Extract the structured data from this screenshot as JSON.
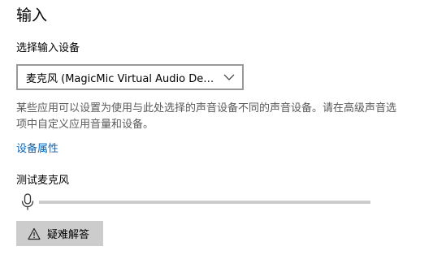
{
  "section": {
    "title": "输入"
  },
  "device_selector": {
    "label": "选择输入设备",
    "selected_value": "麦克风 (MagicMic Virtual Audio Dev...",
    "icon": "chevron-down-icon"
  },
  "description": "某些应用可以设置为使用与此处选择的声音设备不同的声音设备。请在高级声音选项中自定义应用音量和设备。",
  "device_properties_link": "设备属性",
  "mic_test": {
    "label": "测试麦克风",
    "icon": "microphone-icon",
    "level_percent": 0
  },
  "troubleshoot": {
    "label": "疑难解答",
    "icon": "warning-triangle-icon"
  },
  "colors": {
    "link": "#0067c0",
    "button_background": "#cccccc",
    "level_track": "#cccccc",
    "select_border": "#999999"
  }
}
